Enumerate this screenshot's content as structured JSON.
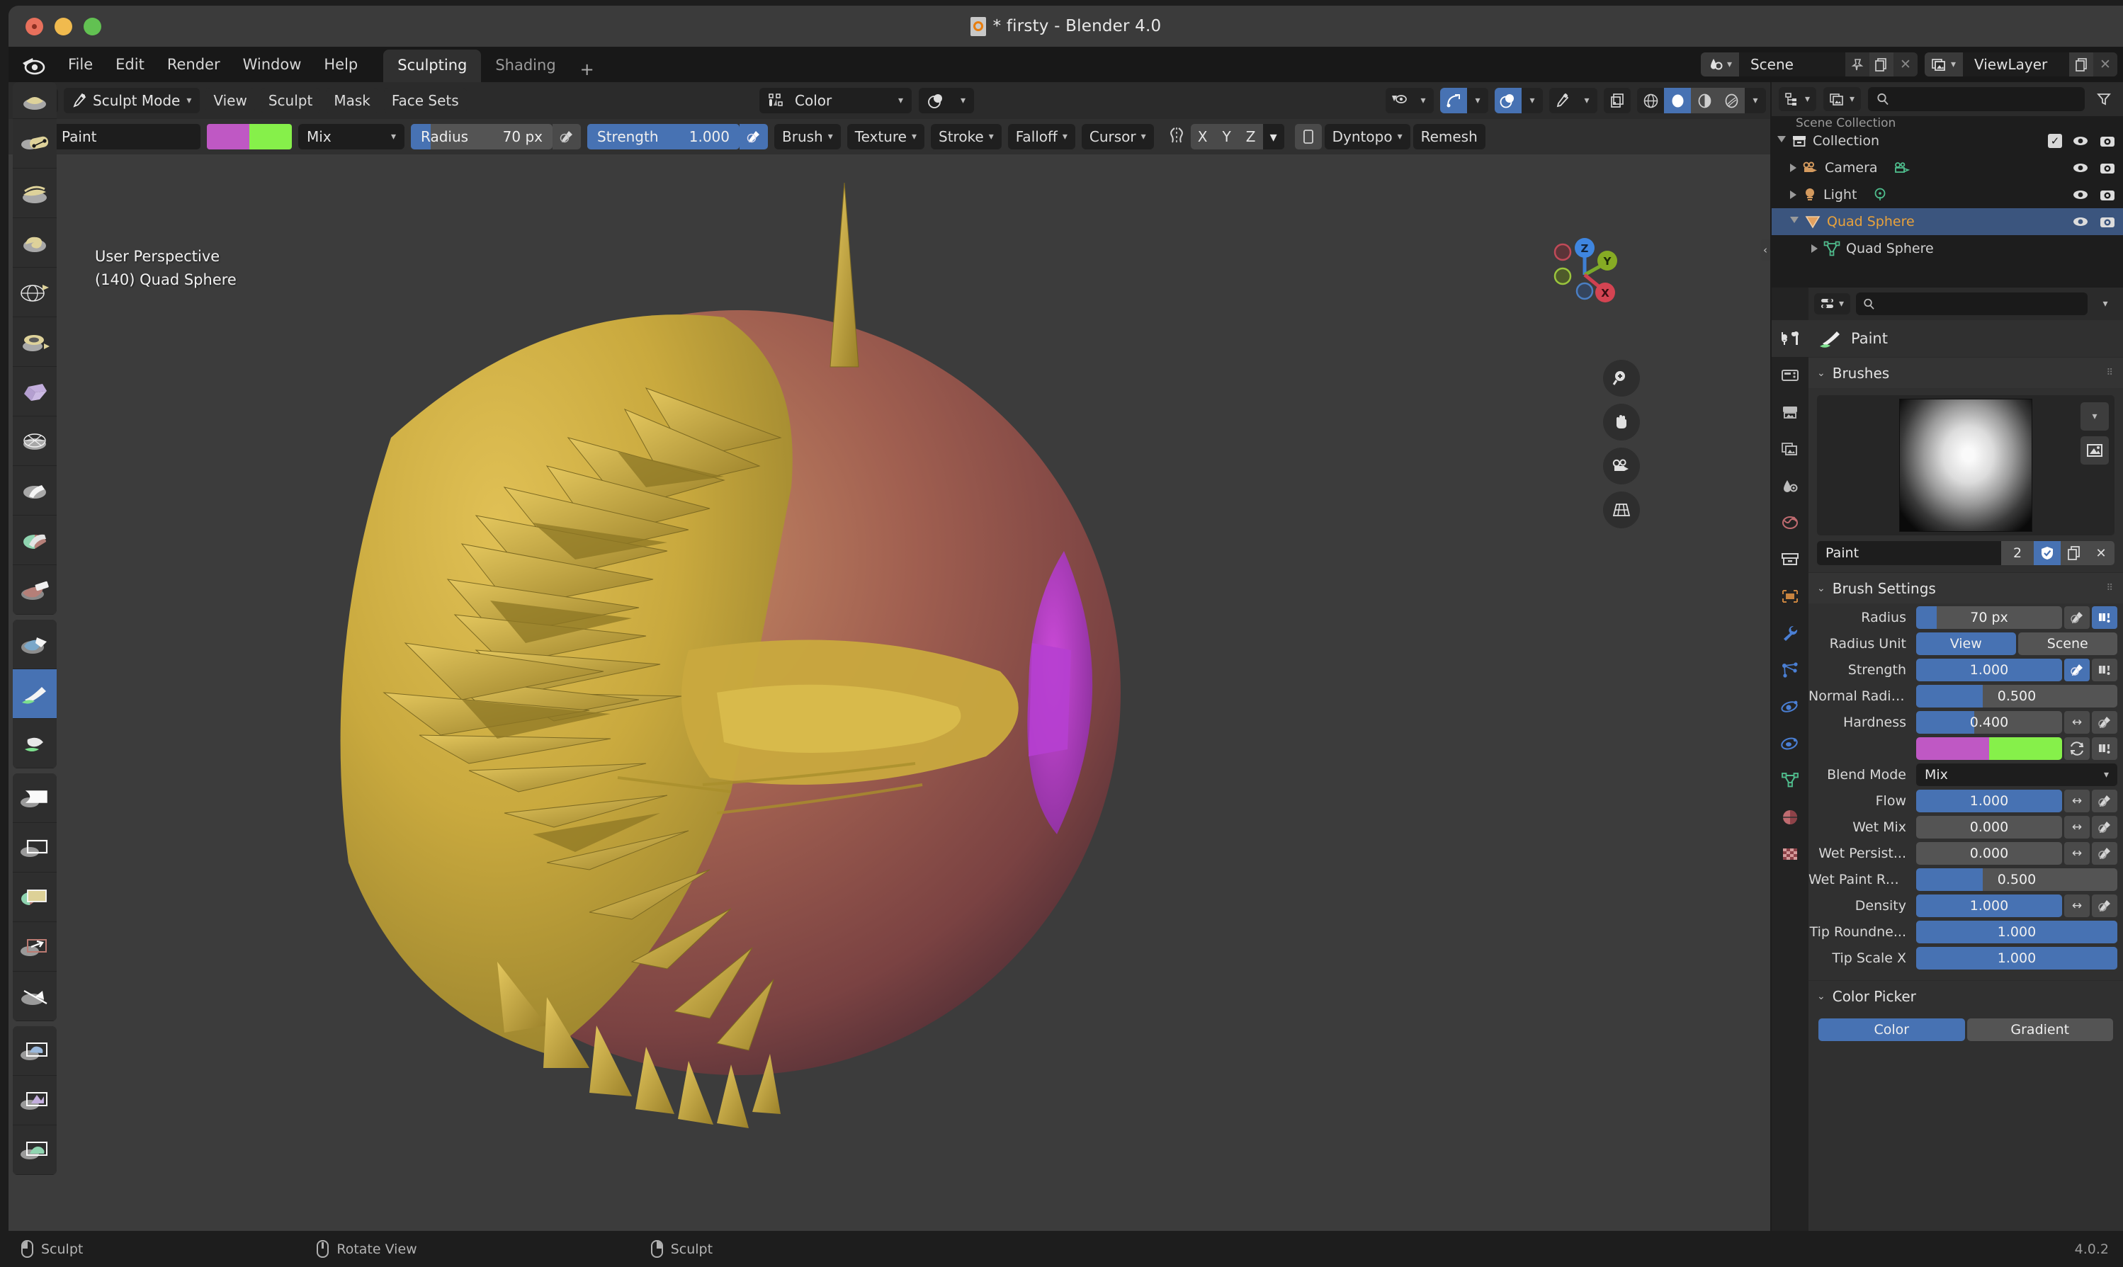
{
  "window": {
    "title": "* firsty - Blender 4.0",
    "traffic_lights": [
      "close",
      "minimize",
      "maximize"
    ]
  },
  "menubar": {
    "logo": "blender-logo",
    "items": [
      "File",
      "Edit",
      "Render",
      "Window",
      "Help"
    ],
    "workspace_tabs": [
      {
        "label": "Sculpting",
        "active": true
      },
      {
        "label": "Shading",
        "active": false
      }
    ],
    "add_workspace": "+",
    "scene": {
      "label": "Scene",
      "icon": "scene-icon",
      "pin": "pin-icon",
      "copy": "copy-icon",
      "close": "x-icon"
    },
    "viewlayer": {
      "label": "ViewLayer",
      "icon": "viewlayer-icon",
      "copy": "copy-icon",
      "close": "x-icon"
    }
  },
  "viewport_header": {
    "editor_type_icon": "editor-type-icon",
    "mode": "Sculpt Mode",
    "mode_icon": "sculpt-mode-icon",
    "menus": [
      "View",
      "Sculpt",
      "Mask",
      "Face Sets"
    ],
    "attribute_selector": {
      "label": "Color",
      "icon": "color-attribute-icon"
    },
    "blend_icon": "overlay-blend-icon",
    "right_icons": [
      "visibility-icon",
      "gizmo-icon",
      "overlays-icon",
      "xray-icon",
      "viewport-shading-wireframe",
      "viewport-shading-solid",
      "viewport-shading-material",
      "viewport-shading-rendered"
    ]
  },
  "tool_settings": {
    "brush_name": "Paint",
    "brush_thumb": "brush-preview-icon",
    "color_primary": "#bf58c4",
    "color_secondary": "#86f04a",
    "blend_mode": "Mix",
    "radius": {
      "label": "Radius",
      "value": "70 px",
      "fill_pct": 14
    },
    "strength": {
      "label": "Strength",
      "value": "1.000",
      "fill_pct": 100
    },
    "popovers": [
      "Brush",
      "Texture",
      "Stroke",
      "Falloff",
      "Cursor"
    ],
    "symmetry_icon": "symmetry-icon",
    "symmetry_axes": [
      "X",
      "Y",
      "Z"
    ],
    "dyntopo": "Dyntopo",
    "remesh": "Remesh"
  },
  "left_toolbar": {
    "tools": [
      {
        "name": "draw-tool",
        "active": false
      },
      {
        "name": "draw-sharp-tool",
        "active": false
      },
      {
        "name": "clay-tool",
        "active": false
      },
      {
        "name": "clay-strips-tool",
        "active": false
      },
      {
        "name": "clay-thumb-tool",
        "active": false
      },
      {
        "name": "layer-tool",
        "active": false
      },
      {
        "name": "inflate-tool",
        "active": false
      },
      {
        "name": "blob-tool",
        "active": false
      },
      {
        "name": "crease-tool",
        "active": false
      },
      {
        "name": "smooth-tool",
        "active": false
      },
      {
        "name": "flatten-tool",
        "active": false
      },
      {
        "name": "fill-tool",
        "active": false
      },
      {
        "name": "scrape-tool",
        "active": false
      },
      {
        "name": "multiplane-scrape-tool",
        "active": false
      },
      {
        "name": "pinch-tool",
        "active": false
      },
      {
        "name": "grab-tool",
        "active": false
      },
      {
        "name": "elastic-deform-tool",
        "active": false
      },
      {
        "name": "snake-hook-tool",
        "active": false
      },
      {
        "name": "thumb-tool",
        "active": false
      },
      {
        "name": "pose-tool",
        "active": false
      },
      {
        "name": "nudge-tool",
        "active": false
      },
      {
        "name": "rotate-tool",
        "active": false
      },
      {
        "name": "slide-relax-tool",
        "active": false
      },
      {
        "name": "boundary-tool",
        "active": false
      },
      {
        "name": "cloth-tool",
        "active": false
      },
      {
        "name": "simplify-tool",
        "active": false
      },
      {
        "name": "mask-tool",
        "active": false
      },
      {
        "name": "draw-face-sets-tool",
        "active": false
      },
      {
        "name": "multires-displacement-eraser-tool",
        "active": false
      },
      {
        "name": "multires-displacement-smear-tool",
        "active": false
      },
      {
        "name": "paint-tool",
        "active": true
      },
      {
        "name": "smear-tool",
        "active": false
      },
      {
        "name": "box-mask-tool",
        "active": false
      },
      {
        "name": "box-hide-tool",
        "active": false
      },
      {
        "name": "box-face-set-tool",
        "active": false
      },
      {
        "name": "box-trim-tool",
        "active": false
      },
      {
        "name": "line-project-tool",
        "active": false
      },
      {
        "name": "mesh-filter-tool",
        "active": false
      },
      {
        "name": "cloth-filter-tool",
        "active": false
      },
      {
        "name": "color-filter-tool",
        "active": false
      }
    ]
  },
  "viewport": {
    "perspective_label": "User Perspective",
    "object_label": "(140) Quad Sphere",
    "gizmo": {
      "x": "X",
      "y": "Y",
      "z": "Z"
    },
    "nav_buttons": [
      "zoom-icon",
      "pan-hand-icon",
      "camera-view-icon",
      "toggle-perspective-icon"
    ],
    "sidebar_toggle": "sidebar-chevron-icon"
  },
  "outliner": {
    "display_mode_icon": "outliner-display-mode-icon",
    "filter_id_icon": "filter-id-icon",
    "search_placeholder": "",
    "search_icon": "search-icon",
    "filter_icon": "filter-funnel-icon",
    "scene_collection": "Scene Collection",
    "rows": [
      {
        "label": "Collection",
        "icon": "collection-icon",
        "indent": 0,
        "selected": false,
        "has_checkbox": true,
        "expand": null,
        "visible_icons": [
          "eye-icon",
          "camera-icon"
        ]
      },
      {
        "label": "Camera",
        "icon": "camera-object-icon",
        "data_icon": "camera-data-icon",
        "indent": 1,
        "selected": false,
        "expand": "collapsed",
        "visible_icons": [
          "eye-icon",
          "camera-icon"
        ]
      },
      {
        "label": "Light",
        "icon": "light-object-icon",
        "data_icon": "light-data-icon",
        "indent": 1,
        "selected": false,
        "expand": "collapsed",
        "visible_icons": [
          "eye-icon",
          "camera-icon"
        ]
      },
      {
        "label": "Quad Sphere",
        "icon": "mesh-object-icon",
        "indent": 1,
        "selected": true,
        "expand": "expanded",
        "visible_icons": [
          "eye-icon",
          "camera-icon"
        ]
      },
      {
        "label": "Quad Sphere",
        "icon": "mesh-data-icon",
        "indent": 2,
        "selected": false,
        "expand": "collapsed",
        "visible_icons": []
      }
    ]
  },
  "properties": {
    "tabs": [
      {
        "name": "tool-tab",
        "active": true
      },
      {
        "name": "render-tab",
        "active": false
      },
      {
        "name": "output-tab",
        "active": false
      },
      {
        "name": "view-layer-tab",
        "active": false
      },
      {
        "name": "scene-tab",
        "active": false
      },
      {
        "name": "world-tab",
        "active": false
      },
      {
        "name": "collection-tab",
        "active": false
      },
      {
        "name": "object-tab",
        "active": false
      },
      {
        "name": "modifier-tab",
        "active": false
      },
      {
        "name": "particles-tab",
        "active": false
      },
      {
        "name": "physics-tab",
        "active": false
      },
      {
        "name": "constraints-tab",
        "active": false
      },
      {
        "name": "object-data-tab",
        "active": false
      },
      {
        "name": "material-tab",
        "active": false
      },
      {
        "name": "texture-tab",
        "active": false
      }
    ],
    "editor_icon": "properties-editor-icon",
    "search_icon": "search-icon",
    "breadcrumb": {
      "icon": "brush-icon",
      "label": "Paint"
    },
    "brushes_panel": {
      "title": "Brushes",
      "preview_icon": "brush-stroke-preview",
      "dropdown_icon": "chevron-down-icon",
      "image_icon": "image-icon",
      "name": "Paint",
      "users": "2",
      "fake_user_icon": "shield-check-icon",
      "duplicate_icon": "copy-icon",
      "delete_icon": "x-icon"
    },
    "brush_settings": {
      "title": "Brush Settings",
      "rows": [
        {
          "label": "Radius",
          "value": "70 px",
          "fill_pct": 14,
          "type": "slider_plain",
          "extras": [
            "pressure-icon",
            "unified-icon-on"
          ]
        },
        {
          "label": "Radius Unit",
          "type": "toggle2",
          "options": [
            "View",
            "Scene"
          ],
          "selected": "View"
        },
        {
          "label": "Strength",
          "value": "1.000",
          "fill_pct": 100,
          "type": "slider",
          "extras": [
            "pressure-icon-on",
            "unified-icon"
          ]
        },
        {
          "label": "Normal Radius",
          "value": "0.500",
          "fill_pct": 33,
          "type": "slider_plain",
          "extras": []
        },
        {
          "label": "Hardness",
          "value": "0.400",
          "fill_pct": 40,
          "type": "slider_plain",
          "extras": [
            "arrows-icon",
            "pressure-icon"
          ]
        },
        {
          "label": "",
          "type": "colorpair",
          "color_a": "#bf58c4",
          "color_b": "#86f04a",
          "extras": [
            "swap-icon",
            "unified-icon"
          ]
        },
        {
          "label": "Blend Mode",
          "type": "dropdown",
          "value": "Mix"
        },
        {
          "label": "Flow",
          "value": "1.000",
          "fill_pct": 100,
          "type": "slider",
          "extras": [
            "arrows-icon",
            "pressure-icon"
          ]
        },
        {
          "label": "Wet Mix",
          "value": "0.000",
          "fill_pct": 0,
          "type": "slider_plain",
          "extras": [
            "arrows-icon",
            "pressure-icon"
          ]
        },
        {
          "label": "Wet Persist...",
          "value": "0.000",
          "fill_pct": 0,
          "type": "slider_plain",
          "extras": [
            "arrows-icon",
            "pressure-icon"
          ]
        },
        {
          "label": "Wet Paint Ra...",
          "value": "0.500",
          "fill_pct": 33,
          "type": "slider_plain",
          "extras": []
        },
        {
          "label": "Density",
          "value": "1.000",
          "fill_pct": 100,
          "type": "slider",
          "extras": [
            "arrows-icon",
            "pressure-icon"
          ]
        },
        {
          "label": "Tip Roundne...",
          "value": "1.000",
          "fill_pct": 100,
          "type": "slider",
          "extras": []
        },
        {
          "label": "Tip Scale X",
          "value": "1.000",
          "fill_pct": 100,
          "type": "slider",
          "extras": []
        }
      ]
    },
    "color_picker_panel": {
      "title": "Color Picker",
      "tabs": [
        "Color",
        "Gradient"
      ],
      "selected_tab": "Color"
    }
  },
  "statusbar": {
    "items": [
      {
        "mouse": "left",
        "label": "Sculpt"
      },
      {
        "mouse": "middle",
        "label": "Rotate View"
      },
      {
        "mouse": "right",
        "label": "Sculpt"
      }
    ],
    "version": "4.0.2"
  }
}
